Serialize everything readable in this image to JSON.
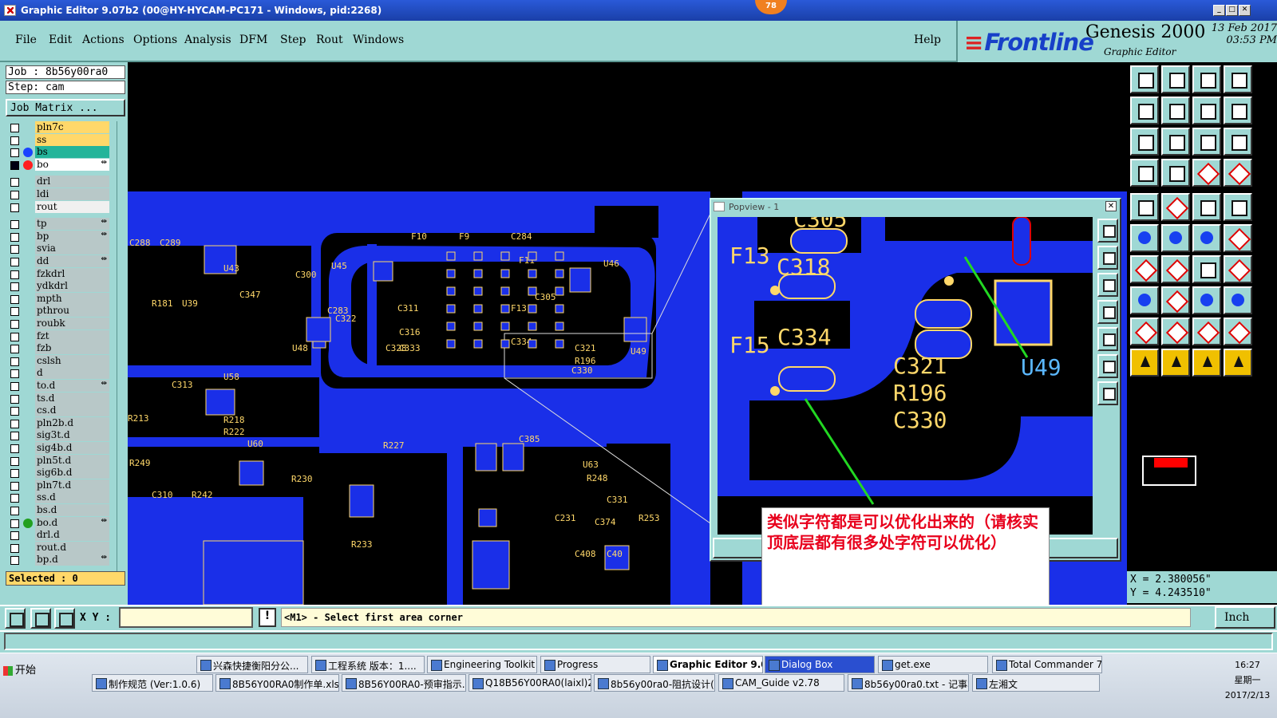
{
  "window": {
    "title": "Graphic Editor 9.07b2 (00@HY-HYCAM-PC171 - Windows, pid:2268)",
    "badge": "78"
  },
  "menu": {
    "items": [
      "File",
      "Edit",
      "Actions",
      "Options",
      "Analysis",
      "DFM",
      "Step",
      "Rout",
      "Windows"
    ],
    "help": "Help"
  },
  "brand": {
    "logo": "Frontline",
    "product": "Genesis 2000",
    "subtitle": "Graphic Editor",
    "date": "13 Feb 2017",
    "time": "03:53 PM"
  },
  "job": {
    "job_line": "Job : 8b56y00ra0",
    "step_line": "Step: cam",
    "matrix_button": "Job Matrix ..."
  },
  "layers": [
    {
      "name": "pln7c",
      "color": "#ffd86a",
      "dot": ""
    },
    {
      "name": "ss",
      "color": "#ffd86a",
      "dot": ""
    },
    {
      "name": "bs",
      "color": "#23b49a",
      "dot": "#1a44ff"
    },
    {
      "name": "bo",
      "color": "#ffffff",
      "dot": "#ff2020",
      "mark": "⇹",
      "selected": true
    },
    {
      "name": "drl",
      "color": "#b8c8c8",
      "dot": ""
    },
    {
      "name": "ldi",
      "color": "#b8c8c8",
      "dot": ""
    },
    {
      "name": "rout",
      "color": "#f0f0f0",
      "dot": ""
    },
    {
      "name": "tp",
      "color": "#b8c8c8",
      "dot": "",
      "mark": "⇹"
    },
    {
      "name": "bp",
      "color": "#b8c8c8",
      "dot": "",
      "mark": "⇹"
    },
    {
      "name": "svia",
      "color": "#b8c8c8",
      "dot": ""
    },
    {
      "name": "dd",
      "color": "#b8c8c8",
      "dot": "",
      "mark": "⇹"
    },
    {
      "name": "fzkdrl",
      "color": "#b8c8c8",
      "dot": ""
    },
    {
      "name": "ydkdrl",
      "color": "#b8c8c8",
      "dot": ""
    },
    {
      "name": "mpth",
      "color": "#b8c8c8",
      "dot": ""
    },
    {
      "name": "pthrou",
      "color": "#b8c8c8",
      "dot": ""
    },
    {
      "name": "roubk",
      "color": "#b8c8c8",
      "dot": ""
    },
    {
      "name": "fzt",
      "color": "#b8c8c8",
      "dot": ""
    },
    {
      "name": "fzb",
      "color": "#b8c8c8",
      "dot": ""
    },
    {
      "name": "cslsh",
      "color": "#b8c8c8",
      "dot": ""
    },
    {
      "name": "d",
      "color": "#b8c8c8",
      "dot": ""
    },
    {
      "name": "to.d",
      "color": "#b8c8c8",
      "dot": "",
      "mark": "⇹"
    },
    {
      "name": "ts.d",
      "color": "#b8c8c8",
      "dot": ""
    },
    {
      "name": "cs.d",
      "color": "#b8c8c8",
      "dot": ""
    },
    {
      "name": "pln2b.d",
      "color": "#b8c8c8",
      "dot": ""
    },
    {
      "name": "sig3t.d",
      "color": "#b8c8c8",
      "dot": ""
    },
    {
      "name": "sig4b.d",
      "color": "#b8c8c8",
      "dot": ""
    },
    {
      "name": "pln5t.d",
      "color": "#b8c8c8",
      "dot": ""
    },
    {
      "name": "sig6b.d",
      "color": "#b8c8c8",
      "dot": ""
    },
    {
      "name": "pln7t.d",
      "color": "#b8c8c8",
      "dot": ""
    },
    {
      "name": "ss.d",
      "color": "#b8c8c8",
      "dot": ""
    },
    {
      "name": "bs.d",
      "color": "#b8c8c8",
      "dot": ""
    },
    {
      "name": "bo.d",
      "color": "#b8c8c8",
      "dot": "#22a020",
      "mark": "⇹"
    },
    {
      "name": "drl.d",
      "color": "#b8c8c8",
      "dot": ""
    },
    {
      "name": "rout.d",
      "color": "#b8c8c8",
      "dot": ""
    },
    {
      "name": "bp.d",
      "color": "#b8c8c8",
      "dot": "",
      "mark": "⇹"
    }
  ],
  "selected_text": "Selected : 0",
  "board": {
    "labels": [
      "C288",
      "C289",
      "U43",
      "C347",
      "U39",
      "R181",
      "U45",
      "C300",
      "C322",
      "C316",
      "C333",
      "U48",
      "C328",
      "C283",
      "F10",
      "F9",
      "C284",
      "U46",
      "C305",
      "C311",
      "F11",
      "F13",
      "C334",
      "C321",
      "R196",
      "C330",
      "U49",
      "U58",
      "C313",
      "R213",
      "R218",
      "R222",
      "U60",
      "R249",
      "R242",
      "C310",
      "R230",
      "R227",
      "C385",
      "U63",
      "R248",
      "C331",
      "C231",
      "R253",
      "C408",
      "C374",
      "R233",
      "C40"
    ],
    "popview_labels": [
      "C305",
      "F13",
      "C318",
      "F15",
      "C334",
      "C321",
      "R196",
      "C330",
      "U49"
    ]
  },
  "popview": {
    "title": "Popview - 1",
    "close": "✕"
  },
  "annotation": {
    "text": "类似字符都是可以优化出来的（请核实　顶底层都有很多处字符可以优化）"
  },
  "coords": {
    "x": "X = 2.380056\"",
    "y": "Y = 4.243510\""
  },
  "command": {
    "xy_label": "X Y :",
    "input_value": "",
    "excl": "!",
    "prompt": "<M1> - Select first area corner",
    "unit": "Inch"
  },
  "taskbar": {
    "start": "开始",
    "row1": [
      {
        "label": "兴森快捷衡阳分公...",
        "state": ""
      },
      {
        "label": "工程系统  版本：1....",
        "state": ""
      },
      {
        "label": "Engineering Toolkit 9....",
        "state": ""
      },
      {
        "label": "Progress",
        "state": ""
      },
      {
        "label": "Graphic Editor 9.07...",
        "state": "active"
      },
      {
        "label": "Dialog Box",
        "state": "dialog"
      },
      {
        "label": "get.exe",
        "state": ""
      },
      {
        "label": "Total Commander 7.0...",
        "state": ""
      }
    ],
    "row2": [
      {
        "label": "制作规范 (Ver:1.0.6)",
        "state": ""
      },
      {
        "label": "8B56Y00RA0制作单.xls ...",
        "state": ""
      },
      {
        "label": "8B56Y00RA0-预审指示...",
        "state": ""
      },
      {
        "label": "Q18B56Y00RA0(laixl)201...",
        "state": ""
      },
      {
        "label": "8b56y00ra0-阻抗设计(...",
        "state": ""
      },
      {
        "label": "CAM_Guide v2.78",
        "state": ""
      },
      {
        "label": "8b56y00ra0.txt - 记事本",
        "state": ""
      },
      {
        "label": "左湘文",
        "state": ""
      }
    ],
    "clock_time": "16:27",
    "clock_day": "星期一",
    "clock_date": "2017/2/13"
  }
}
